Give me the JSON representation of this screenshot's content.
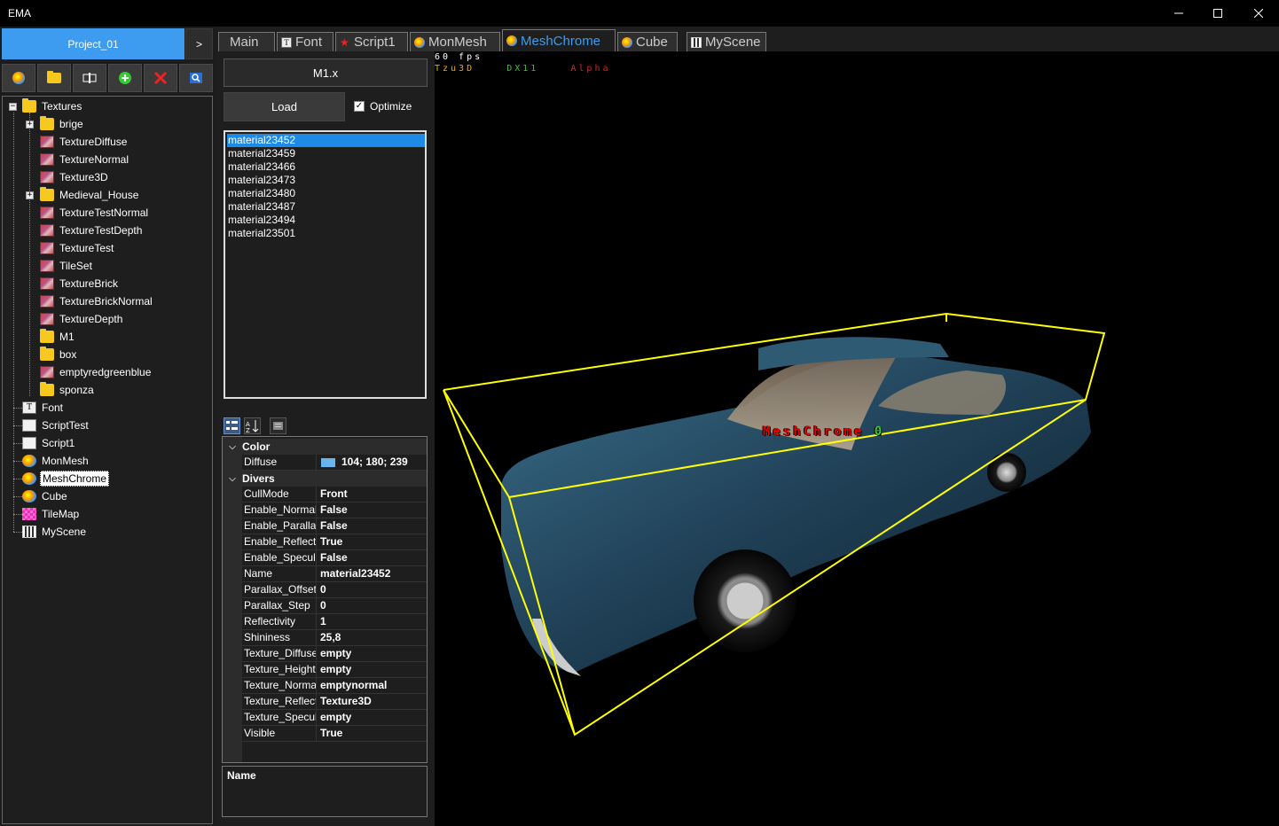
{
  "window": {
    "title": "EMA"
  },
  "project": {
    "name": "Project_01",
    "next_label": ">"
  },
  "toolbar": {
    "buttons": [
      "mesh-icon",
      "folder-icon",
      "rename-icon",
      "add-icon",
      "delete-icon",
      "search-icon"
    ]
  },
  "tree": {
    "items": [
      {
        "label": "Textures",
        "icon": "folder-icon"
      },
      {
        "label": "brige",
        "icon": "folder-icon"
      },
      {
        "label": "TextureDiffuse",
        "icon": "texture-icon"
      },
      {
        "label": "TextureNormal",
        "icon": "texture-icon"
      },
      {
        "label": "Texture3D",
        "icon": "texture-icon"
      },
      {
        "label": "Medieval_House",
        "icon": "folder-icon"
      },
      {
        "label": "TextureTestNormal",
        "icon": "texture-icon"
      },
      {
        "label": "TextureTestDepth",
        "icon": "texture-icon"
      },
      {
        "label": "TextureTest",
        "icon": "texture-icon"
      },
      {
        "label": "TileSet",
        "icon": "texture-icon"
      },
      {
        "label": "TextureBrick",
        "icon": "texture-icon"
      },
      {
        "label": "TextureBrickNormal",
        "icon": "texture-icon"
      },
      {
        "label": "TextureDepth",
        "icon": "texture-icon"
      },
      {
        "label": "M1",
        "icon": "folder-icon"
      },
      {
        "label": "box",
        "icon": "folder-icon"
      },
      {
        "label": "emptyredgreenblue",
        "icon": "texture-icon"
      },
      {
        "label": "sponza",
        "icon": "folder-icon"
      },
      {
        "label": "Font",
        "icon": "font-icon"
      },
      {
        "label": "ScriptTest",
        "icon": "script-icon"
      },
      {
        "label": "Script1",
        "icon": "script-icon"
      },
      {
        "label": "MonMesh",
        "icon": "mesh-icon"
      },
      {
        "label": "MeshChrome",
        "icon": "mesh-icon"
      },
      {
        "label": "Cube",
        "icon": "mesh-icon"
      },
      {
        "label": "TileMap",
        "icon": "tilemap-icon"
      },
      {
        "label": "MyScene",
        "icon": "scene-icon"
      }
    ],
    "selected": "MeshChrome"
  },
  "tabs": [
    {
      "label": "Main",
      "icon": ""
    },
    {
      "label": "Font",
      "icon": "font-icon"
    },
    {
      "label": "Script1",
      "icon": "script-icon"
    },
    {
      "label": "MonMesh",
      "icon": "mesh-icon"
    },
    {
      "label": "MeshChrome",
      "icon": "mesh-icon"
    },
    {
      "label": "Cube",
      "icon": "mesh-icon"
    },
    {
      "label": "MyScene",
      "icon": "scene-icon"
    }
  ],
  "active_tab": "MeshChrome",
  "mesh_panel": {
    "file": "M1.x",
    "load_label": "Load",
    "optimize_label": "Optimize",
    "optimize_checked": true,
    "check_glyph": "✓",
    "materials": [
      "material23452",
      "material23459",
      "material23466",
      "material23473",
      "material23480",
      "material23487",
      "material23494",
      "material23501"
    ],
    "selected_material": "material23452"
  },
  "property_grid": {
    "categories": [
      {
        "name": "Color",
        "rows": [
          {
            "key": "Diffuse",
            "value": "104; 180; 239",
            "swatch": "#68b4ef"
          }
        ]
      },
      {
        "name": "Divers",
        "rows": [
          {
            "key": "CullMode",
            "value": "Front"
          },
          {
            "key": "Enable_Normal",
            "value": "False"
          },
          {
            "key": "Enable_Parallax",
            "value": "False"
          },
          {
            "key": "Enable_Reflection",
            "value": "True"
          },
          {
            "key": "Enable_Specular",
            "value": "False"
          },
          {
            "key": "Name",
            "value": "material23452"
          },
          {
            "key": "Parallax_Offset",
            "value": "0"
          },
          {
            "key": "Parallax_Step",
            "value": "0"
          },
          {
            "key": "Reflectivity",
            "value": "1"
          },
          {
            "key": "Shininess",
            "value": "25,8"
          },
          {
            "key": "Texture_Diffuse",
            "value": "empty"
          },
          {
            "key": "Texture_Height",
            "value": "empty"
          },
          {
            "key": "Texture_Normal",
            "value": "emptynormal"
          },
          {
            "key": "Texture_Reflection",
            "value": "Texture3D"
          },
          {
            "key": "Texture_Specular",
            "value": "empty"
          },
          {
            "key": "Visible",
            "value": "True"
          }
        ]
      }
    ],
    "help_title": "Name"
  },
  "viewport": {
    "fps_text": "60 fps",
    "engine": "Tzu3D",
    "api": "DX11",
    "mode": "Alpha",
    "object_label": "MeshChrome",
    "object_index": "0",
    "colors": {
      "fps": "#ffffff",
      "engine": "#f2a900",
      "api": "#3fbf3f",
      "mode": "#e02020",
      "bbox": "#ffff00",
      "car": "#1f3f55"
    }
  },
  "colors": {
    "accent": "#3d9bf0",
    "selection": "#1e8ae8"
  }
}
